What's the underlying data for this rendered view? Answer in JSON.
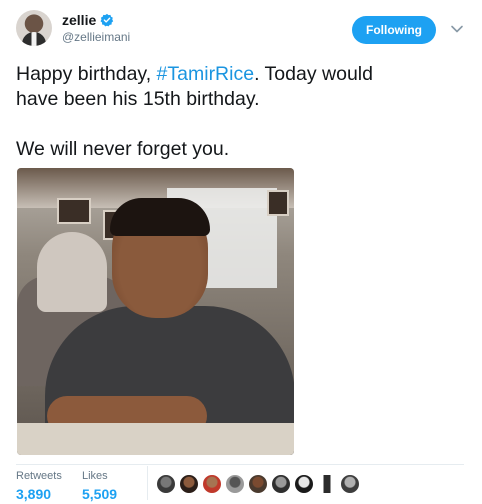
{
  "author": {
    "display_name": "zellie",
    "handle": "@zellieimani",
    "avatar_icon": "user-avatar-icon",
    "verified_icon": "verified-badge-icon"
  },
  "follow_button": {
    "label": "Following"
  },
  "menu_icon": "chevron-down-icon",
  "tweet": {
    "line1_before": "Happy birthday, ",
    "hashtag": "#TamirRice",
    "line1_after": ". Today would",
    "line2": "have been his 15th birthday.",
    "line3": "We will never forget you."
  },
  "stats": {
    "retweets_label": "Retweets",
    "retweets_value": "3,890",
    "likes_label": "Likes",
    "likes_value": "5,509"
  },
  "likers": [
    "liker-avatar-1",
    "liker-avatar-2",
    "liker-avatar-3",
    "liker-avatar-4",
    "liker-avatar-5",
    "liker-avatar-6",
    "liker-avatar-7",
    "liker-avatar-8",
    "liker-avatar-9"
  ],
  "colors": {
    "accent": "#1da1f2",
    "hashtag": "#1b95e0",
    "secondary_text": "#657786",
    "primary_text": "#14171a"
  }
}
